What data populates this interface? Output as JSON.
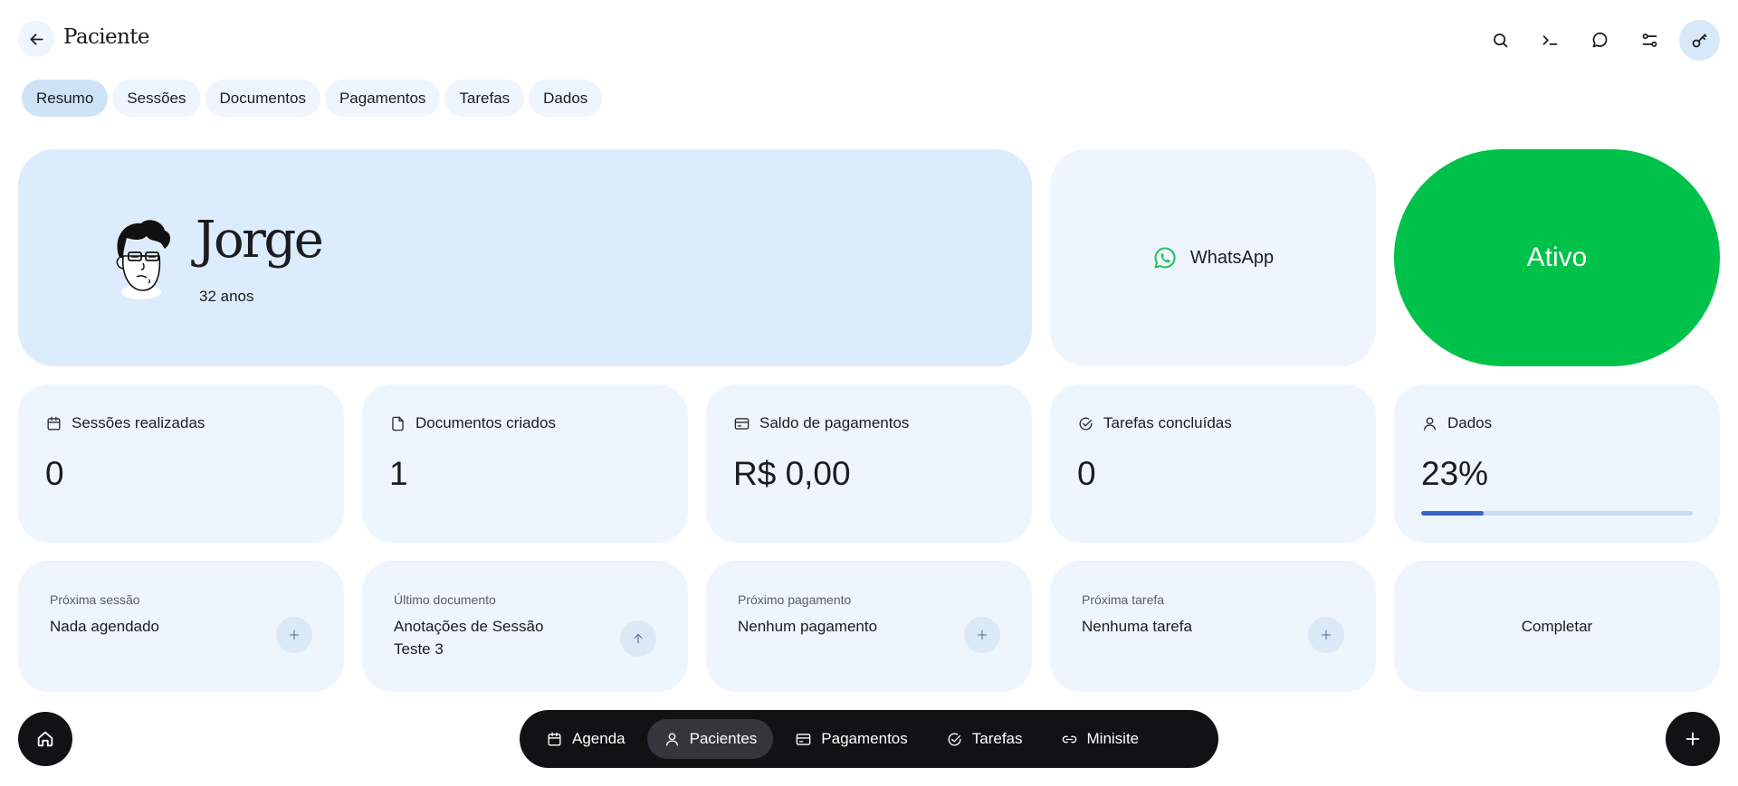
{
  "header": {
    "title": "Paciente",
    "actions": [
      {
        "icon": "search-icon"
      },
      {
        "icon": "terminal-icon"
      },
      {
        "icon": "chat-icon"
      },
      {
        "icon": "sliders-icon"
      },
      {
        "icon": "key-icon",
        "active": true
      }
    ]
  },
  "tabs": [
    {
      "label": "Resumo",
      "active": true
    },
    {
      "label": "Sessões"
    },
    {
      "label": "Documentos"
    },
    {
      "label": "Pagamentos"
    },
    {
      "label": "Tarefas"
    },
    {
      "label": "Dados"
    }
  ],
  "patient": {
    "name": "Jorge",
    "age": "32 anos"
  },
  "contact": {
    "label": "WhatsApp",
    "icon": "whatsapp-icon"
  },
  "status": {
    "label": "Ativo",
    "color": "#00c24b"
  },
  "stats": [
    {
      "icon": "calendar-icon",
      "label": "Sessões realizadas",
      "value": "0"
    },
    {
      "icon": "document-icon",
      "label": "Documentos criados",
      "value": "1"
    },
    {
      "icon": "credit-card-icon",
      "label": "Saldo de pagamentos",
      "value": "R$ 0,00"
    },
    {
      "icon": "check-circle-icon",
      "label": "Tarefas concluídas",
      "value": "0"
    },
    {
      "icon": "user-icon",
      "label": "Dados",
      "value": "23%",
      "progress": 0.23
    }
  ],
  "next_items": [
    {
      "label": "Próxima sessão",
      "value": "Nada agendado",
      "action_icon": "plus-icon"
    },
    {
      "label": "Último documento",
      "value": "Anotações de Sessão Teste 3",
      "action_icon": "arrow-up-icon"
    },
    {
      "label": "Próximo pagamento",
      "value": "Nenhum pagamento",
      "action_icon": "plus-icon"
    },
    {
      "label": "Próxima tarefa",
      "value": "Nenhuma tarefa",
      "action_icon": "plus-icon"
    }
  ],
  "complete_label": "Completar",
  "bottom_nav": [
    {
      "icon": "calendar-icon",
      "label": "Agenda"
    },
    {
      "icon": "user-icon",
      "label": "Pacientes",
      "active": true
    },
    {
      "icon": "credit-card-icon",
      "label": "Pagamentos"
    },
    {
      "icon": "check-circle-icon",
      "label": "Tarefas"
    },
    {
      "icon": "link-icon",
      "label": "Minisite"
    }
  ],
  "colors": {
    "accent": "#3b64c6",
    "card": "#eef5fc",
    "hero": "#dcecfc",
    "nav": "#111214"
  }
}
